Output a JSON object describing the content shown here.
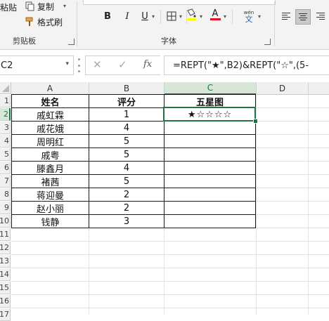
{
  "ribbon": {
    "paste_label": "粘贴",
    "copy_label": "复制",
    "format_painter_label": "格式刷",
    "clipboard_group_label": "剪贴板",
    "font_group_label": "字体",
    "bold_glyph": "B",
    "italic_glyph": "I",
    "underline_glyph": "U",
    "font_color_glyph": "A",
    "wen_top": "wén",
    "wen_bottom": "文",
    "highlight_color": "#ffff00",
    "font_color": "#e81123"
  },
  "formula_bar": {
    "name_box": "C2",
    "fx": "fx",
    "formula": "=REPT(\"★\",B2)&REPT(\"☆\",(5-"
  },
  "columns": [
    "A",
    "B",
    "C",
    "D"
  ],
  "row_numbers": [
    "1",
    "2",
    "3",
    "4",
    "5",
    "6",
    "7",
    "8",
    "9",
    "10",
    "11",
    "12",
    "13",
    "14",
    "15",
    "16",
    "17"
  ],
  "table": {
    "headers": [
      "姓名",
      "评分",
      "五星图"
    ],
    "rows": [
      {
        "name": "戚虹霖",
        "score": "1",
        "stars": "★☆☆☆☆"
      },
      {
        "name": "戚花娥",
        "score": "4",
        "stars": ""
      },
      {
        "name": "周明红",
        "score": "5",
        "stars": ""
      },
      {
        "name": "戚粤",
        "score": "5",
        "stars": ""
      },
      {
        "name": "滕鑫月",
        "score": "4",
        "stars": ""
      },
      {
        "name": "褚茜",
        "score": "5",
        "stars": ""
      },
      {
        "name": "蒋迎曼",
        "score": "2",
        "stars": ""
      },
      {
        "name": "赵小丽",
        "score": "2",
        "stars": ""
      },
      {
        "name": "钱静",
        "score": "3",
        "stars": ""
      }
    ]
  },
  "selected_cell": "C2",
  "accent_color": "#217346"
}
